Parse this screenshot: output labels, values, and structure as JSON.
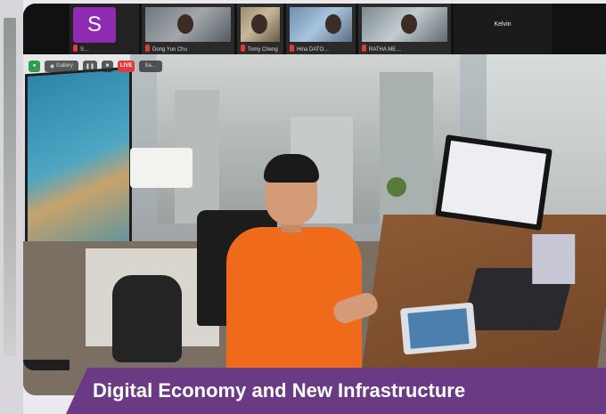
{
  "participants": [
    {
      "avatar_letter": "S",
      "name": "S…",
      "type": "avatar"
    },
    {
      "name": "Dong Yun Chu",
      "type": "camera"
    },
    {
      "name": "Tomy Cheng",
      "type": "camera"
    },
    {
      "name": "Hina DATO…",
      "type": "camera"
    },
    {
      "name": "RATHA ME…",
      "type": "camera"
    },
    {
      "name": "Kelvin",
      "type": "name-only"
    }
  ],
  "toolbar": {
    "view_label": "Gallery",
    "live_label": "LIVE",
    "live_detail": "Sa…"
  },
  "caption": {
    "text": "Digital Economy and New Infrastructure"
  },
  "colors": {
    "caption_bg": "#6a3b84",
    "avatar_bg": "#8e2bb0",
    "shirt": "#f06a1b",
    "live_badge": "#e23b3b"
  }
}
